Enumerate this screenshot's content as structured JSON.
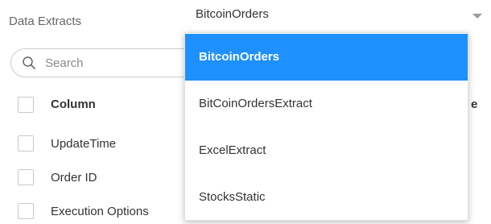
{
  "extracts": {
    "label": "Data Extracts",
    "selected_value": "BitcoinOrders"
  },
  "search": {
    "placeholder": "Search",
    "value": ""
  },
  "columns": {
    "header": "Column",
    "partial_header": "e",
    "rows": [
      {
        "label": "UpdateTime"
      },
      {
        "label": "Order ID"
      },
      {
        "label": "Execution Options"
      }
    ]
  },
  "dropdown": {
    "options": [
      {
        "label": "BitcoinOrders",
        "selected": true
      },
      {
        "label": "BitCoinOrdersExtract",
        "selected": false
      },
      {
        "label": "ExcelExtract",
        "selected": false
      },
      {
        "label": "StocksStatic",
        "selected": false
      }
    ]
  },
  "colors": {
    "accent": "#1e90ff",
    "text": "#333333",
    "muted": "#666666",
    "border": "#cccccc"
  }
}
